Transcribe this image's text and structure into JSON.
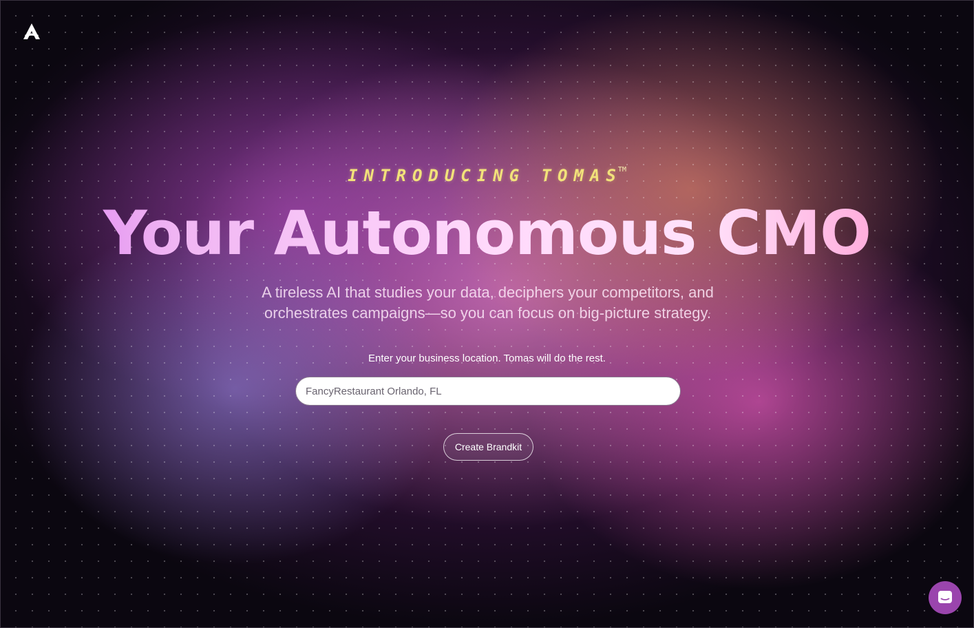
{
  "brand": {
    "logo_icon": "a-triangle-logo-icon"
  },
  "hero": {
    "eyebrow": "INTRODUCING TOMAS",
    "eyebrow_mark": "TM",
    "headline": "Your Autonomous CMO",
    "subhead": "A tireless AI that studies your data, deciphers your competitors, and orchestrates campaigns—so you can focus on big-picture strategy."
  },
  "form": {
    "prompt": "Enter your business location. Tomas will do the rest.",
    "input_value": "",
    "input_placeholder": "FancyRestaurant Orlando, FL",
    "submit_label": "Create Brandkit"
  },
  "chat": {
    "icon": "chat-bubble-icon"
  },
  "colors": {
    "eyebrow": "#f2e27a",
    "chat_button": "#9a45ad"
  }
}
